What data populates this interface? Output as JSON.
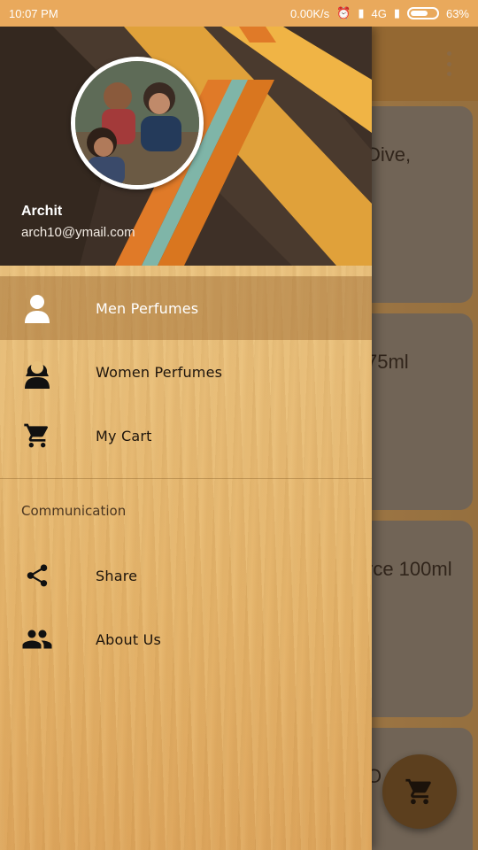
{
  "status_bar": {
    "time": "10:07 PM",
    "network_speed": "0.00K/s",
    "network_type": "4G",
    "battery": "63%"
  },
  "background": {
    "cards": [
      {
        "text": "Dive,"
      },
      {
        "text": "75ml"
      },
      {
        "text": "rce 100ml"
      },
      {
        "text": "O"
      }
    ]
  },
  "drawer": {
    "user_name": "Archit",
    "user_email": "arch10@ymail.com",
    "items": [
      {
        "label": "Men Perfumes",
        "icon": "man-icon",
        "selected": true
      },
      {
        "label": "Women Perfumes",
        "icon": "woman-icon",
        "selected": false
      },
      {
        "label": "My Cart",
        "icon": "cart-icon",
        "selected": false
      }
    ],
    "section_title": "Communication",
    "comm_items": [
      {
        "label": "Share",
        "icon": "share-icon"
      },
      {
        "label": "About Us",
        "icon": "group-icon"
      }
    ]
  },
  "colors": {
    "status_bar": "#e9a95c",
    "header_bg": "#3d2f26",
    "fab": "#5c3f1e",
    "selected_item": "#a06a2d"
  }
}
